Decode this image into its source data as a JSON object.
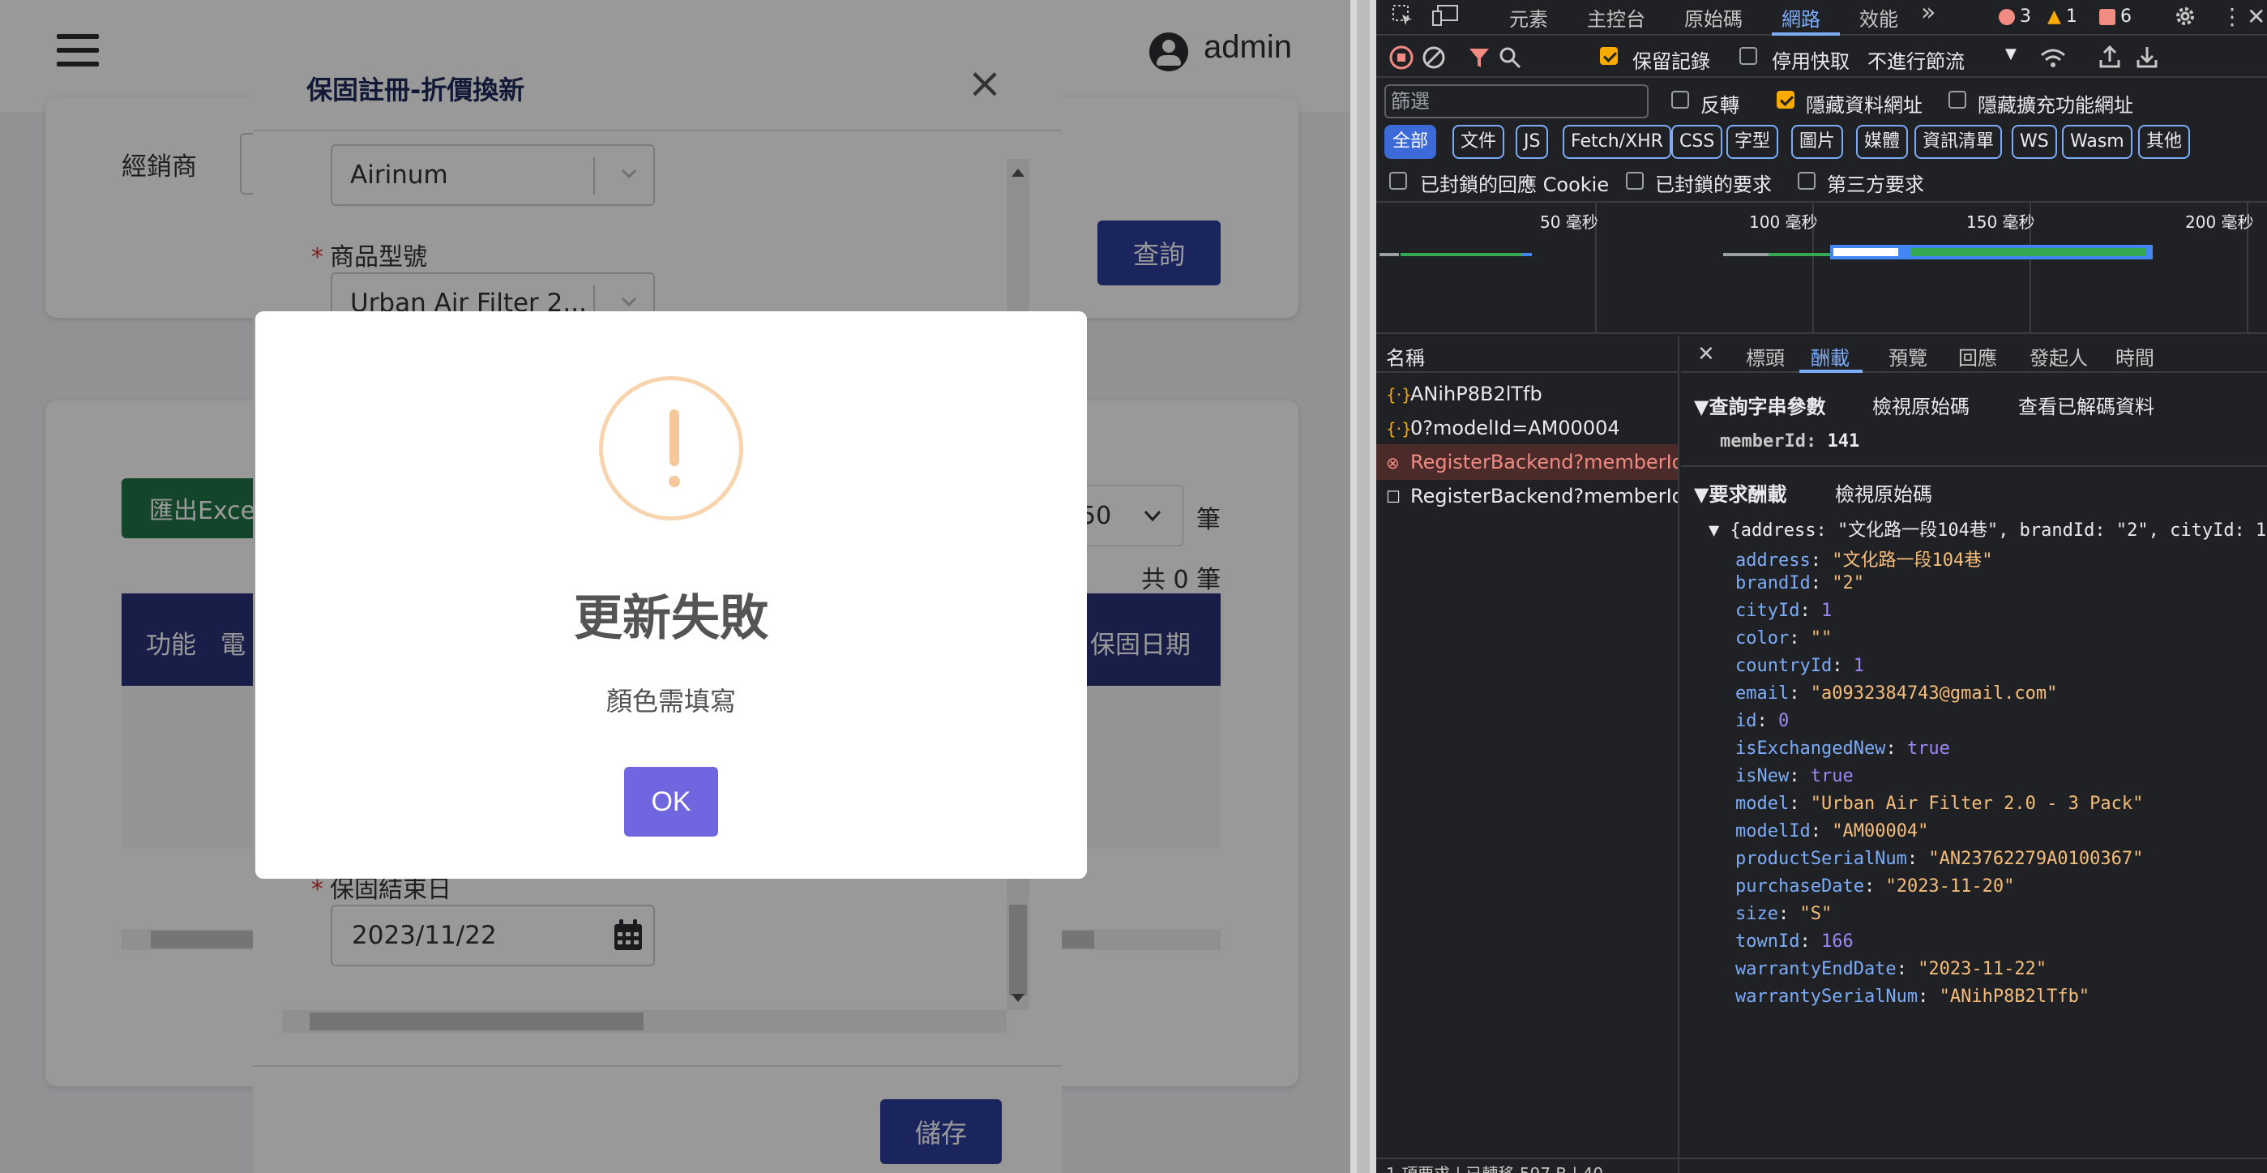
{
  "app": {
    "user_name": "admin",
    "dealer_label": "經銷商",
    "query_button": "查詢",
    "export_button": "匯出Excel",
    "page_size_value": "50",
    "page_unit": "筆",
    "total_count": "共 0 筆",
    "table_headers": [
      "功能",
      "電",
      "保固日期"
    ]
  },
  "register_modal": {
    "title": "保固註冊-折價換新",
    "close_glyph": "×",
    "brand_value": "Airinum",
    "model_label": "商品型號",
    "model_value": "Urban Air Filter 2...",
    "end_date_label": "保固結束日",
    "end_date_value": "2023/11/22",
    "save_button": "儲存"
  },
  "alert": {
    "icon": "!",
    "title": "更新失敗",
    "message": "顏色需填寫",
    "ok_button": "OK",
    "icon_color": "#f8bb86",
    "button_color": "#7066e0"
  },
  "devtools": {
    "panel_tabs": [
      "元素",
      "主控台",
      "原始碼",
      "網路",
      "效能"
    ],
    "active_tab": "網路",
    "more_tabs": "»",
    "errors": "3",
    "warnings": "1",
    "issues": "6",
    "toolbar": {
      "preserve_log": "保留記錄",
      "disable_cache": "停用快取",
      "throttling": "不進行節流"
    },
    "filter_placeholder": "篩選",
    "invert_label": "反轉",
    "hide_data_urls": "隱藏資料網址",
    "hide_extension_urls": "隱藏擴充功能網址",
    "type_filters": [
      "全部",
      "文件",
      "JS",
      "Fetch/XHR",
      "CSS",
      "字型",
      "圖片",
      "媒體",
      "資訊清單",
      "WS",
      "Wasm",
      "其他"
    ],
    "blocked_cookies": "已封鎖的回應 Cookie",
    "blocked_requests": "已封鎖的要求",
    "third_party": "第三方要求",
    "timeline_labels": [
      "50 毫秒",
      "100 毫秒",
      "150 毫秒",
      "200 毫秒"
    ],
    "name_header": "名稱",
    "requests": [
      {
        "name": "ANihP8B2lTfb",
        "status": "fetch"
      },
      {
        "name": "0?modelId=AM00004",
        "status": "fetch"
      },
      {
        "name": "RegisterBackend?memberId...",
        "status": "error"
      },
      {
        "name": "RegisterBackend?memberId...",
        "status": "doc"
      }
    ],
    "detail_tabs": [
      "標頭",
      "酬載",
      "預覽",
      "回應",
      "發起人",
      "時間"
    ],
    "active_detail_tab": "酬載",
    "query_section": "▼查詢字串參數",
    "view_source": "檢視原始碼",
    "view_decoded": "查看已解碼資料",
    "query_params": [
      {
        "key": "memberId",
        "value": "141"
      }
    ],
    "payload_section": "▼要求酬載",
    "payload_summary": "▼ {address: \"文化路一段104巷\", brandId: \"2\", cityId: 1",
    "payload": [
      {
        "key": "address",
        "value": "\"文化路一段104巷\"",
        "type": "string"
      },
      {
        "key": "brandId",
        "value": "\"2\"",
        "type": "string"
      },
      {
        "key": "cityId",
        "value": "1",
        "type": "number"
      },
      {
        "key": "color",
        "value": "\"\"",
        "type": "string"
      },
      {
        "key": "countryId",
        "value": "1",
        "type": "number"
      },
      {
        "key": "email",
        "value": "\"a0932384743@gmail.com\"",
        "type": "string"
      },
      {
        "key": "id",
        "value": "0",
        "type": "number"
      },
      {
        "key": "isExchangedNew",
        "value": "true",
        "type": "bool"
      },
      {
        "key": "isNew",
        "value": "true",
        "type": "bool"
      },
      {
        "key": "model",
        "value": "\"Urban Air Filter 2.0 - 3 Pack\"",
        "type": "string"
      },
      {
        "key": "modelId",
        "value": "\"AM00004\"",
        "type": "string"
      },
      {
        "key": "productSerialNum",
        "value": "\"AN23762279A0100367\"",
        "type": "string"
      },
      {
        "key": "purchaseDate",
        "value": "\"2023-11-20\"",
        "type": "string"
      },
      {
        "key": "size",
        "value": "\"S\"",
        "type": "string"
      },
      {
        "key": "townId",
        "value": "166",
        "type": "number"
      },
      {
        "key": "warrantyEndDate",
        "value": "\"2023-11-22\"",
        "type": "string"
      },
      {
        "key": "warrantySerialNum",
        "value": "\"ANihP8B2lTfb\"",
        "type": "string"
      }
    ],
    "status_bar": "1 項要求 | 已轉移 597 B | 40"
  }
}
